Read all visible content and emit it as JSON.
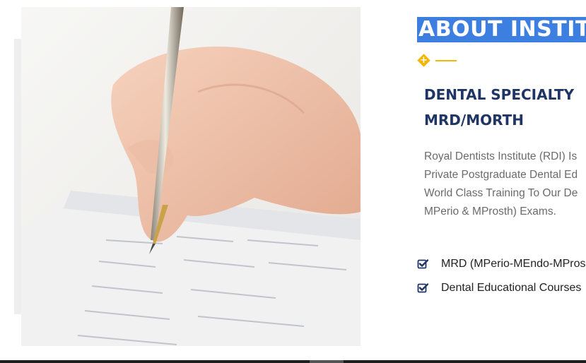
{
  "about": {
    "title": "ABOUT INSTITU",
    "subheading_lines": [
      "DENTAL SPECIALTY",
      "MRD/MORTH"
    ],
    "body_lines": [
      "Royal Dentists Institute (RDI) Is",
      "Private Postgraduate Dental Ed",
      "World Class Training To Our De",
      "MPerio & MProsth) Exams."
    ]
  },
  "features": [
    {
      "label": "MRD (MPerio-MEndo-MPros",
      "icon": "checkbox-checked-icon"
    },
    {
      "label": "Dental Educational Courses",
      "icon": "checkbox-checked-icon"
    }
  ],
  "divider": {
    "icon": "plus-diamond-icon"
  },
  "colors": {
    "title_highlight": "#3d7fe0",
    "heading": "#1f3565",
    "accent": "#f2b705",
    "body_text": "#6b6b6b",
    "check": "#1f3565"
  }
}
